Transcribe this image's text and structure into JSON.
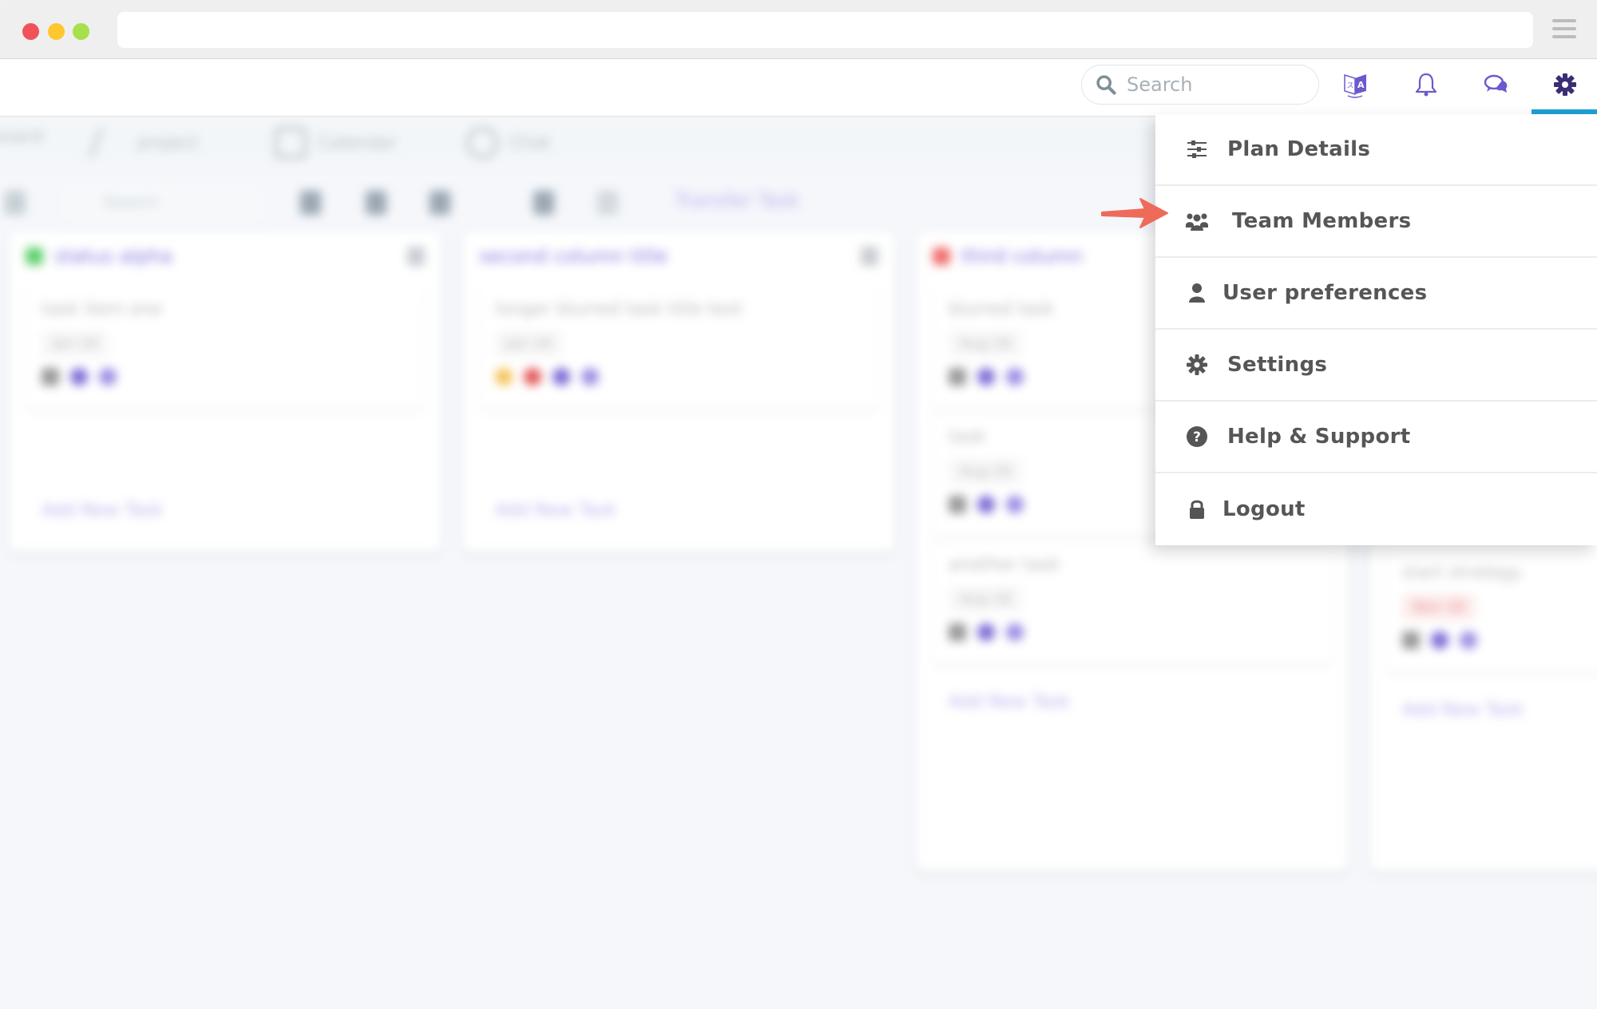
{
  "browser": {
    "traffic_lights": [
      "close",
      "minimize",
      "maximize"
    ],
    "url": "",
    "menu_icon": "hamburger-icon"
  },
  "header": {
    "search": {
      "placeholder": "Search",
      "value": ""
    },
    "icons": [
      "translate-icon",
      "bell-icon",
      "chat-icon",
      "gear-icon"
    ],
    "active_icon": "gear-icon",
    "accent_color": "#1e9fd3",
    "icon_color": "#6a5acd"
  },
  "background_board": {
    "blurred": true,
    "tabs": [
      "board",
      "project",
      "Calendar",
      "Chat"
    ],
    "toolbar": {
      "search_placeholder": "Search",
      "transfer_label": "Transfer Task"
    },
    "columns": [
      {
        "title": "status alpha",
        "status_color": "#5ccf6a",
        "cards": [
          {
            "title": "task item one",
            "date": "Jan 18",
            "overdue": false
          }
        ],
        "add_label": "Add New Task"
      },
      {
        "title": "second column title",
        "status_color": null,
        "cards": [
          {
            "title": "longer blurred task title text",
            "date": "Jan 18",
            "overdue": false
          }
        ],
        "add_label": "Add New Task"
      },
      {
        "title": "third column",
        "status_color": "#ef6b6b",
        "cards": [
          {
            "title": "blurred task",
            "date": "Aug 18",
            "overdue": false
          },
          {
            "title": "task",
            "date": "Aug 18",
            "overdue": false
          },
          {
            "title": "another task",
            "date": "Aug 18",
            "overdue": false
          }
        ],
        "add_label": "Add New Task"
      },
      {
        "title": "",
        "status_color": null,
        "cards": [
          {
            "title": "start strategy",
            "date": "Nov 18",
            "overdue": true
          }
        ],
        "add_label": "Add New Task"
      }
    ]
  },
  "dropdown_menu": {
    "items": [
      {
        "label": "Plan Details",
        "icon": "sliders-icon"
      },
      {
        "label": "Team Members",
        "icon": "users-icon",
        "highlighted_by_arrow": true
      },
      {
        "label": "User preferences",
        "icon": "user-icon"
      },
      {
        "label": "Settings",
        "icon": "gear-icon"
      },
      {
        "label": "Help & Support",
        "icon": "question-circle-icon"
      },
      {
        "label": "Logout",
        "icon": "lock-icon"
      }
    ]
  },
  "annotation": {
    "type": "arrow",
    "color": "#ee6b5a",
    "points_to": "Team Members"
  }
}
